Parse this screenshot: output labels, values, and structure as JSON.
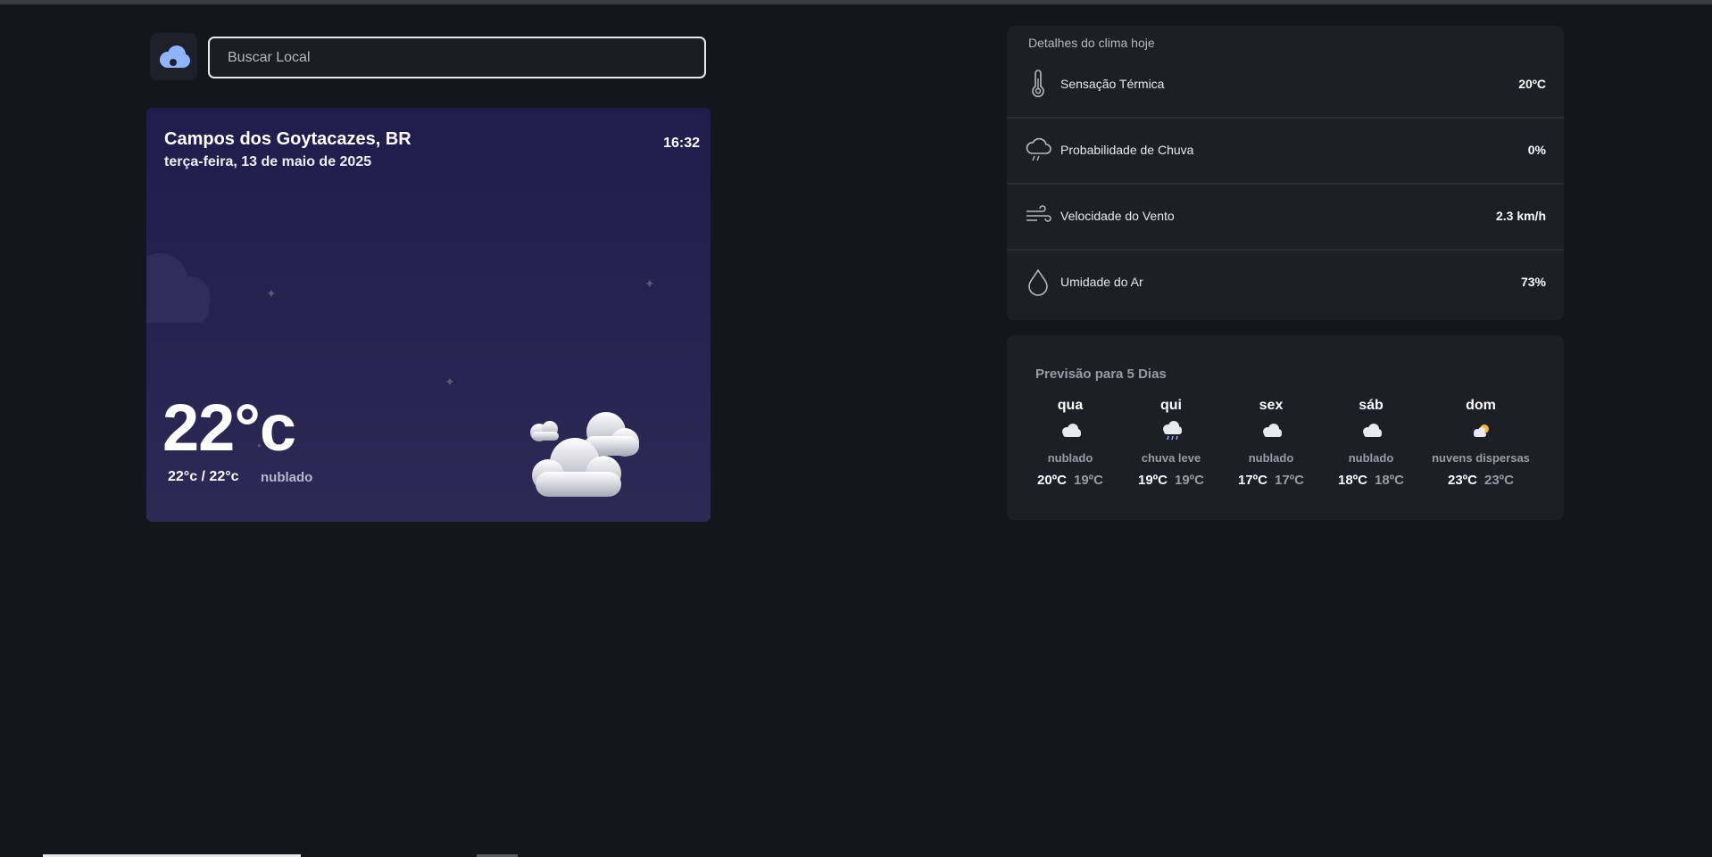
{
  "search": {
    "placeholder": "Buscar Local"
  },
  "current": {
    "city": "Campos dos Goytacazes, BR",
    "date": "terça-feira, 13 de maio de 2025",
    "time": "16:32",
    "temperature": "22°c",
    "min_max": "22°c / 22°c",
    "condition": "nublado"
  },
  "details": {
    "heading": "Detalhes do clima hoje",
    "rows": [
      {
        "label": "Sensação Térmica",
        "value": "20ºC",
        "icon": "thermometer-icon"
      },
      {
        "label": "Probabilidade de Chuva",
        "value": "0%",
        "icon": "rain-cloud-icon"
      },
      {
        "label": "Velocidade do Vento",
        "value": "2.3 km/h",
        "icon": "wind-icon"
      },
      {
        "label": "Umidade do Ar",
        "value": "73%",
        "icon": "droplet-icon"
      }
    ]
  },
  "forecast": {
    "heading": "Previsão para 5 Dias",
    "days": [
      {
        "day": "qua",
        "desc": "nublado",
        "max": "20ºC",
        "min": "19ºC",
        "icon": "cloudy-icon"
      },
      {
        "day": "qui",
        "desc": "chuva leve",
        "max": "19ºC",
        "min": "19ºC",
        "icon": "light-rain-icon"
      },
      {
        "day": "sex",
        "desc": "nublado",
        "max": "17ºC",
        "min": "17ºC",
        "icon": "cloudy-icon"
      },
      {
        "day": "sáb",
        "desc": "nublado",
        "max": "18ºC",
        "min": "18ºC",
        "icon": "cloudy-icon"
      },
      {
        "day": "dom",
        "desc": "nuvens dispersas",
        "max": "23ºC",
        "min": "23ºC",
        "icon": "partly-cloudy-icon"
      }
    ]
  },
  "colors": {
    "background": "#15161b",
    "card": "#1d1e26",
    "hero_top": "#1f1d4c",
    "hero_bottom": "#2e2855",
    "logo_accent": "#8fb3ff"
  }
}
